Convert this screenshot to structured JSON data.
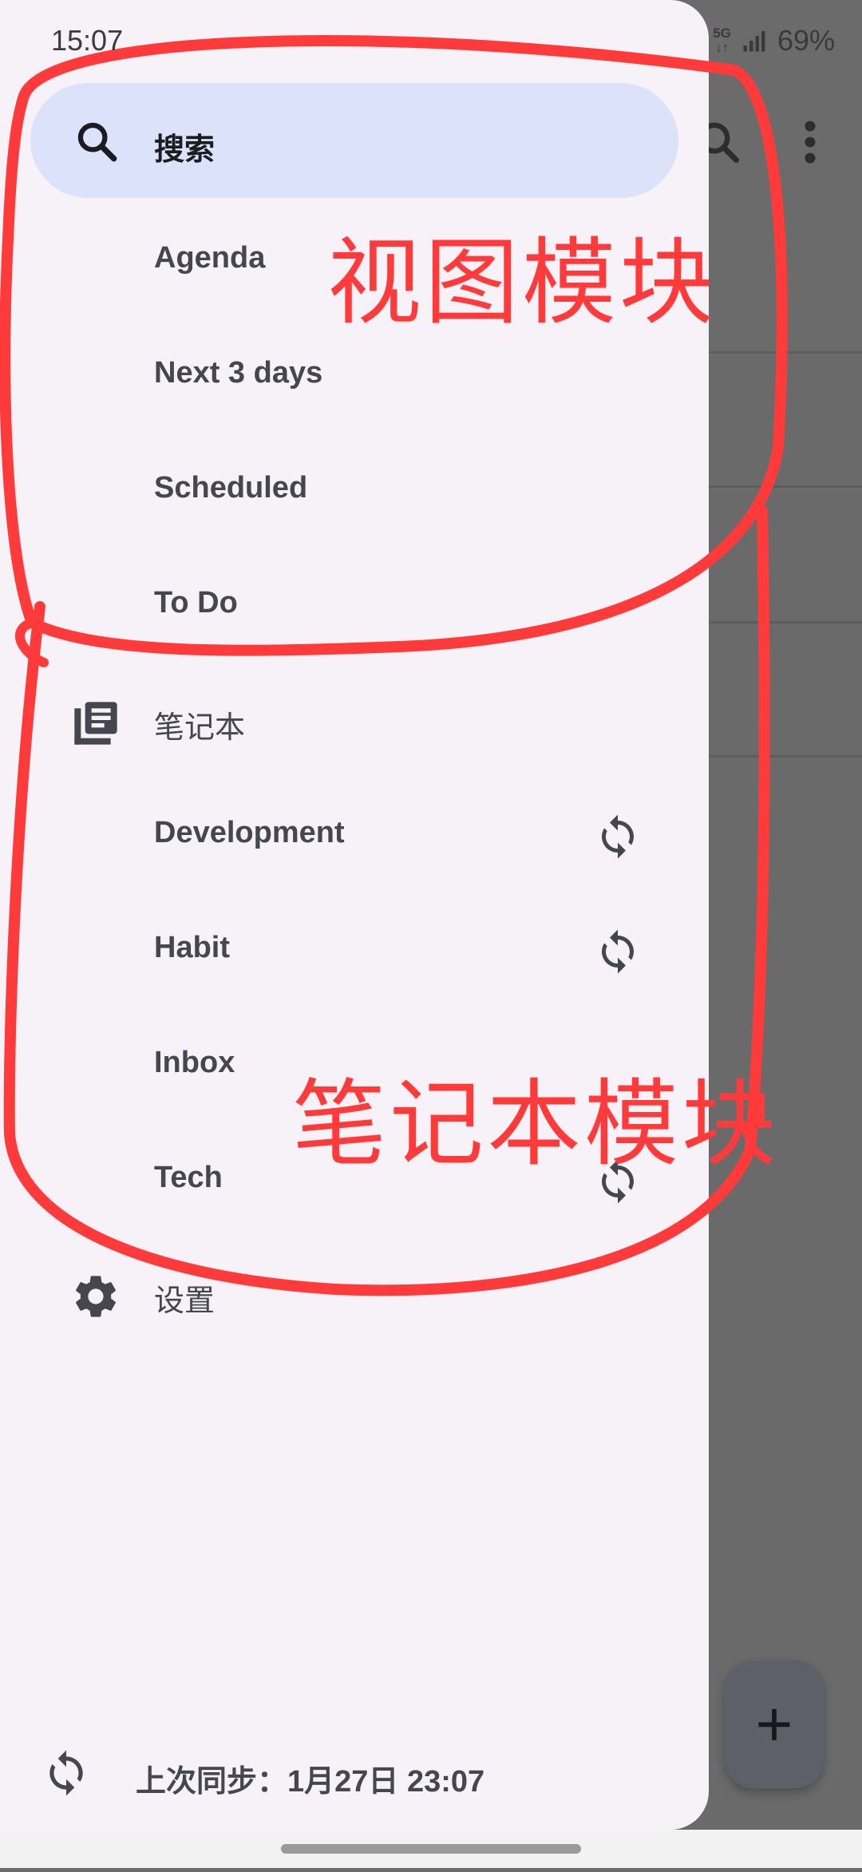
{
  "status_bar": {
    "time": "15:07",
    "network": "5G",
    "battery": "69%"
  },
  "drawer": {
    "search": {
      "label": "搜索",
      "icon": "search-icon"
    },
    "views": [
      {
        "label": "Agenda"
      },
      {
        "label": "Next 3 days"
      },
      {
        "label": "Scheduled"
      },
      {
        "label": "To Do"
      }
    ],
    "notebooks_section": {
      "label": "笔记本",
      "icon": "notebook-icon"
    },
    "notebooks": [
      {
        "label": "Development",
        "synced": true
      },
      {
        "label": "Habit",
        "synced": true
      },
      {
        "label": "Inbox",
        "synced": false
      },
      {
        "label": "Tech",
        "synced": true
      }
    ],
    "settings": {
      "label": "设置",
      "icon": "gear-icon"
    },
    "last_sync": {
      "label": "上次同步：1月27日 23:07",
      "icon": "sync-icon"
    }
  },
  "annotations": {
    "views_module": "视图模块",
    "notebooks_module": "笔记本模块",
    "color": "#ff3a3a"
  },
  "background": {
    "fab_label": "+"
  }
}
